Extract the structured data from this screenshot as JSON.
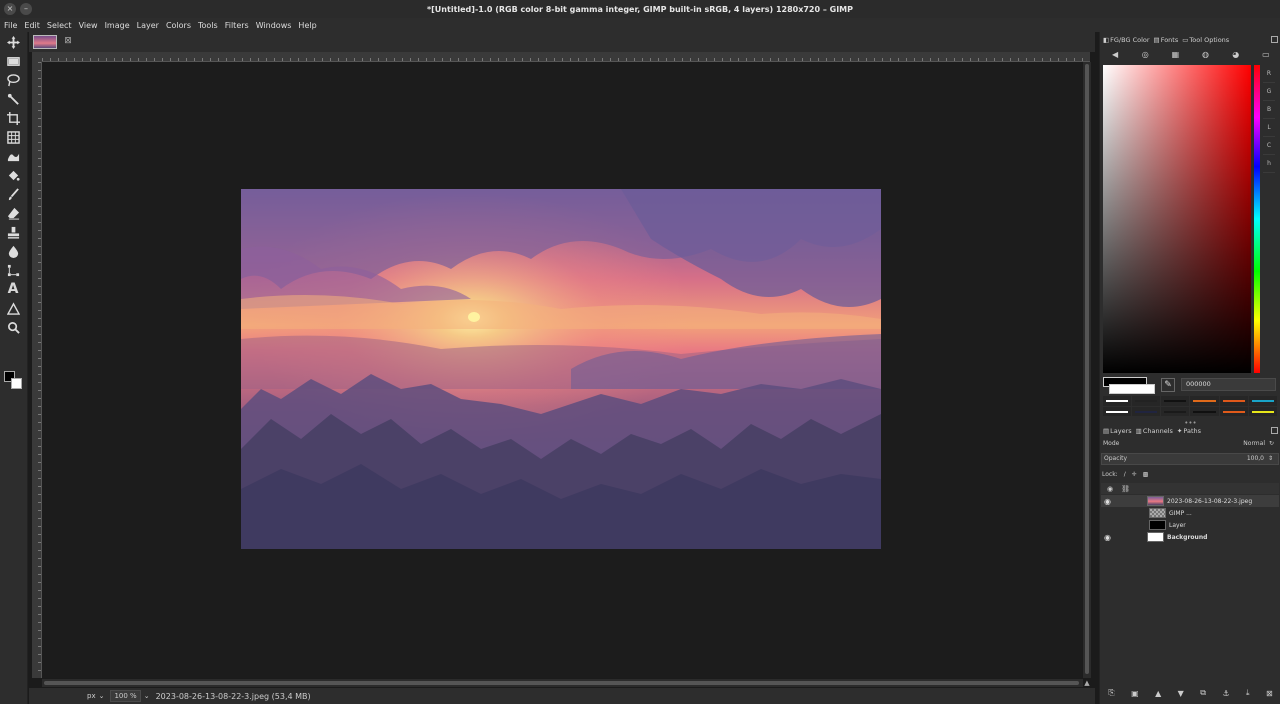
{
  "window": {
    "title": "*[Untitled]-1.0 (RGB color 8-bit gamma integer, GIMP built-in sRGB, 4 layers) 1280x720 – GIMP",
    "close_glyph": "×",
    "minimize_glyph": "–"
  },
  "menu": [
    "File",
    "Edit",
    "Select",
    "View",
    "Image",
    "Layer",
    "Colors",
    "Tools",
    "Filters",
    "Windows",
    "Help"
  ],
  "toolbox": {
    "tools": [
      "move-tool-icon",
      "rect-select-icon",
      "free-select-icon",
      "fuzzy-select-icon",
      "crop-icon",
      "unified-transform-icon",
      "warp-transform-icon",
      "bucket-fill-icon",
      "paintbrush-icon",
      "eraser-icon",
      "clone-icon",
      "smudge-icon",
      "paths-icon",
      "text-icon",
      "measure-icon",
      "zoom-icon"
    ],
    "text_tool_glyph": "A",
    "fg_color": "#000000",
    "bg_color": "#ffffff"
  },
  "image_tab": {
    "close_glyph": "⊠"
  },
  "statusbar": {
    "unit": "px",
    "zoom": "100 %",
    "status_text": "2023-08-26-13-08-22-3.jpeg (53,4 MB)",
    "dropdown_glyph": "⌄"
  },
  "dock": {
    "top_tabs": [
      "FG/BG Color",
      "Fonts",
      "Tool Options"
    ],
    "color_modes": [
      "gimp-icon",
      "cmyk-icon",
      "watercolor-icon",
      "wheel-icon",
      "triangle-icon",
      "scales-icon"
    ],
    "channels": [
      "R",
      "G",
      "B",
      "L",
      "C",
      "h"
    ],
    "hex_value": "000000",
    "picker_glyph": "✎",
    "swatch_colors": [
      "#ffffff",
      "#222222",
      "#111111",
      "#e06a1a",
      "#e0581a",
      "#19a3c7",
      "#ffffff",
      "#20243f",
      "#1a1a1a",
      "#101010",
      "#e05a1a",
      "#e6e61a"
    ],
    "separator_glyph": "•••",
    "layer_tabs": [
      "Layers",
      "Channels",
      "Paths"
    ],
    "mode_label": "Mode",
    "mode_value": "Normal",
    "opacity_label": "Opacity",
    "opacity_value": "100,0",
    "lock_label": "Lock:",
    "layers": [
      {
        "name": "2023-08-26-13-08-22-3.jpeg",
        "visible": true,
        "selected": true
      },
      {
        "name": "GIMP ...",
        "visible": false,
        "selected": false
      },
      {
        "name": "Layer",
        "visible": false,
        "selected": false
      },
      {
        "name": "Background",
        "visible": true,
        "selected": false
      }
    ],
    "eye_glyph": "◉",
    "bottom_buttons": [
      "new-layer-group-icon",
      "new-layer-icon",
      "raise-layer-icon",
      "lower-layer-icon",
      "duplicate-layer-icon",
      "anchor-icon",
      "merge-down-icon",
      "delete-layer-icon"
    ]
  },
  "image": {
    "palette": [
      "#5c5391",
      "#e97983",
      "#f6cf88",
      "#4b4167"
    ]
  }
}
